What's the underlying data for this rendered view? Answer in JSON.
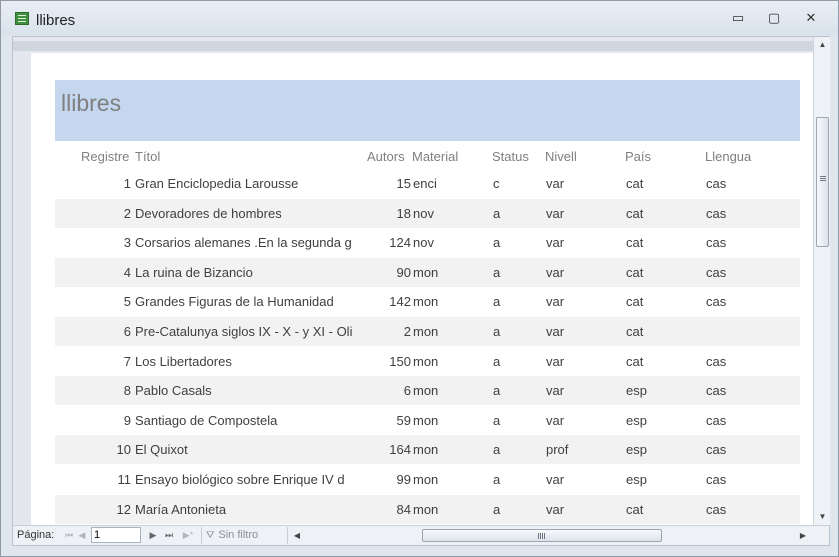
{
  "window": {
    "title": "llibres"
  },
  "window_controls": {
    "minimize": "▭",
    "restore": "▢",
    "close": "✕"
  },
  "report": {
    "title": "llibres",
    "columns": [
      "Registre",
      "Títol",
      "Autors",
      "Material",
      "Status",
      "Nivell",
      "País",
      "Llengua"
    ],
    "rows": [
      {
        "registre": "1",
        "titol": " Gran Enciclopedia Larousse",
        "autors": "15",
        "material": "enci",
        "status": "c",
        "nivell": "var",
        "pais": "cat",
        "llengua": "cas"
      },
      {
        "registre": "2",
        "titol": "Devoradores de hombres",
        "autors": "18",
        "material": "nov",
        "status": "a",
        "nivell": "var",
        "pais": "cat",
        "llengua": "cas"
      },
      {
        "registre": "3",
        "titol": "Corsarios alemanes .En la segunda g",
        "autors": "124",
        "material": "nov",
        "status": "a",
        "nivell": "var",
        "pais": "cat",
        "llengua": "cas"
      },
      {
        "registre": "4",
        "titol": "La ruina de Bizancio",
        "autors": "90",
        "material": "mon",
        "status": "a",
        "nivell": "var",
        "pais": "cat",
        "llengua": "cas"
      },
      {
        "registre": "5",
        "titol": "Grandes Figuras de la Humanidad",
        "autors": "142",
        "material": "mon",
        "status": "a",
        "nivell": "var",
        "pais": "cat",
        "llengua": "cas"
      },
      {
        "registre": "6",
        "titol": "Pre-Catalunya siglos IX - X - y XI - Oli",
        "autors": "2",
        "material": "mon",
        "status": "a",
        "nivell": "var",
        "pais": "cat",
        "llengua": ""
      },
      {
        "registre": "7",
        "titol": "Los Libertadores",
        "autors": "150",
        "material": "mon",
        "status": "a",
        "nivell": "var",
        "pais": "cat",
        "llengua": "cas"
      },
      {
        "registre": "8",
        "titol": "Pablo Casals",
        "autors": "6",
        "material": "mon",
        "status": "a",
        "nivell": "var",
        "pais": "esp",
        "llengua": "cas"
      },
      {
        "registre": "9",
        "titol": "Santiago de Compostela",
        "autors": "59",
        "material": "mon",
        "status": "a",
        "nivell": "var",
        "pais": "esp",
        "llengua": "cas"
      },
      {
        "registre": "10",
        "titol": "El Quixot",
        "autors": "164",
        "material": "mon",
        "status": "a",
        "nivell": "prof",
        "pais": "esp",
        "llengua": "cas"
      },
      {
        "registre": "11",
        "titol": "Ensayo biológico sobre Enrique IV d",
        "autors": "99",
        "material": "mon",
        "status": "a",
        "nivell": "var",
        "pais": "esp",
        "llengua": "cas"
      },
      {
        "registre": "12",
        "titol": "María Antonieta",
        "autors": "84",
        "material": "mon",
        "status": "a",
        "nivell": "var",
        "pais": "cat",
        "llengua": "cas"
      }
    ]
  },
  "navigation": {
    "page_label": "Página:",
    "page_value": "1",
    "first": "⏮",
    "prev": "◀",
    "next": "▶",
    "last": "⏭",
    "new": "▶*",
    "filter_label": "Sin filtro"
  },
  "colors": {
    "header_band": "#c5d7ef",
    "alt_row": "#f2f2f2",
    "text": "#404040"
  }
}
